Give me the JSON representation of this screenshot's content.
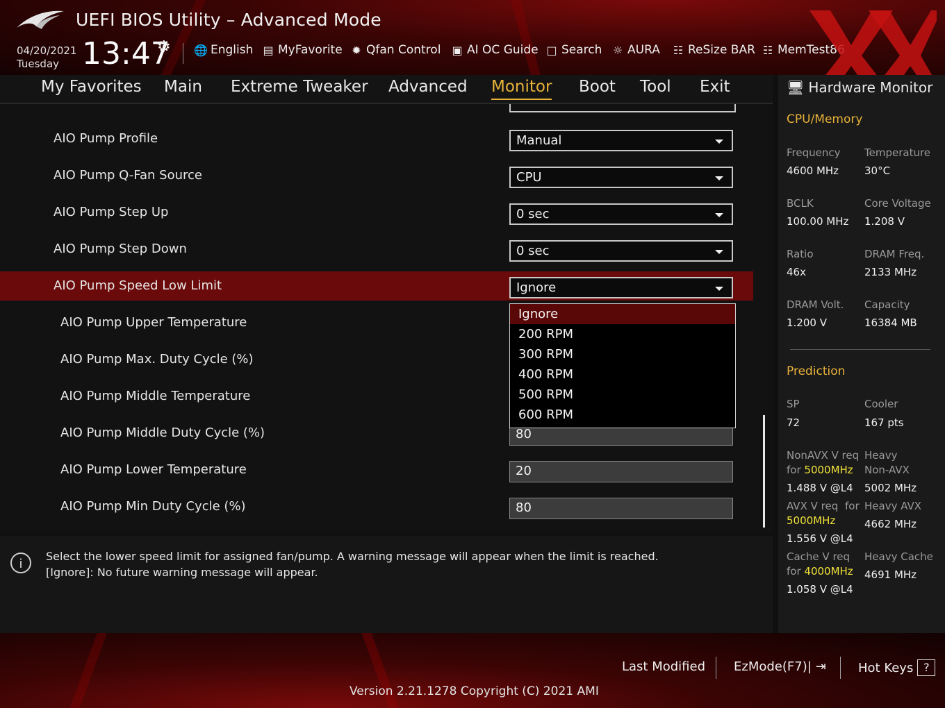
{
  "header": {
    "title": "UEFI BIOS Utility – Advanced Mode",
    "date": "04/20/2021",
    "day": "Tuesday",
    "time": "13:47",
    "tools": [
      {
        "label": "English",
        "icon": "globe-icon"
      },
      {
        "label": "MyFavorite",
        "icon": "favorite-icon"
      },
      {
        "label": "Qfan Control",
        "icon": "fan-icon"
      },
      {
        "label": "AI OC Guide",
        "icon": "chip-icon"
      },
      {
        "label": "Search",
        "icon": "help-box-icon"
      },
      {
        "label": "AURA",
        "icon": "light-icon"
      },
      {
        "label": "ReSize BAR",
        "icon": "resize-bar-icon"
      },
      {
        "label": "MemTest86",
        "icon": "memory-icon"
      }
    ]
  },
  "nav": {
    "tabs": [
      "My Favorites",
      "Main",
      "Extreme Tweaker",
      "Advanced",
      "Monitor",
      "Boot",
      "Tool",
      "Exit"
    ],
    "active": "Monitor"
  },
  "settings": [
    {
      "label": "AIO Pump Profile",
      "value": "Manual"
    },
    {
      "label": "AIO Pump Q-Fan Source",
      "value": "CPU"
    },
    {
      "label": "AIO Pump Step Up",
      "value": "0 sec"
    },
    {
      "label": "AIO Pump Step Down",
      "value": "0 sec"
    },
    {
      "label": "AIO Pump Speed Low Limit",
      "value": "Ignore"
    },
    {
      "label": "AIO Pump Upper Temperature",
      "value": ""
    },
    {
      "label": "AIO Pump Max. Duty Cycle (%)",
      "value": ""
    },
    {
      "label": "AIO Pump Middle Temperature",
      "value": ""
    },
    {
      "label": "AIO Pump Middle Duty Cycle (%)",
      "value": "80"
    },
    {
      "label": "AIO Pump Lower Temperature",
      "value": "20"
    },
    {
      "label": "AIO Pump Min Duty Cycle (%)",
      "value": "80"
    }
  ],
  "dropdown": {
    "options": [
      "Ignore",
      "200 RPM",
      "300 RPM",
      "400 RPM",
      "500 RPM",
      "600 RPM"
    ],
    "highlighted": "Ignore"
  },
  "info": {
    "line1": "Select the lower speed limit for assigned fan/pump. A warning message will appear when the limit is reached.",
    "line2": "[Ignore]: No future warning message will appear."
  },
  "hw_monitor": {
    "title": "Hardware Monitor",
    "cpu_memory": {
      "section": "CPU/Memory",
      "frequency_label": "Frequency",
      "frequency": "4600 MHz",
      "temperature_label": "Temperature",
      "temperature": "30°C",
      "bclk_label": "BCLK",
      "bclk": "100.00 MHz",
      "core_voltage_label": "Core Voltage",
      "core_voltage": "1.208 V",
      "ratio_label": "Ratio",
      "ratio": "46x",
      "dram_freq_label": "DRAM Freq.",
      "dram_freq": "2133 MHz",
      "dram_volt_label": "DRAM Volt.",
      "dram_volt": "1.200 V",
      "capacity_label": "Capacity",
      "capacity": "16384 MB"
    },
    "prediction": {
      "section": "Prediction",
      "sp_label": "SP",
      "sp": "72",
      "cooler_label": "Cooler",
      "cooler": "167 pts",
      "nonavx_label1": "NonAVX V req",
      "nonavx_for": "for",
      "nonavx_freq": "5000MHz",
      "nonavx_value": "1.488 V @L4",
      "heavy_nonavx_label1": "Heavy",
      "heavy_nonavx_label2": "Non-AVX",
      "heavy_nonavx": "5002 MHz",
      "avx_label1": "AVX V req",
      "avx_for": "for",
      "avx_freq": "5000MHz",
      "avx_value": "1.556 V @L4",
      "heavy_avx_label": "Heavy AVX",
      "heavy_avx": "4662 MHz",
      "cache_label1": "Cache V req",
      "cache_for": "for",
      "cache_freq": "4000MHz",
      "cache_value": "1.058 V @L4",
      "heavy_cache_label": "Heavy Cache",
      "heavy_cache": "4691 MHz"
    }
  },
  "footer": {
    "last_modified": "Last Modified",
    "ezmode": "EzMode(F7)|",
    "hotkeys": "Hot Keys",
    "hotkeys_key": "?",
    "version": "Version 2.21.1278 Copyright (C) 2021 AMI"
  },
  "colors": {
    "accent": "#e8b23a",
    "selection": "#6b0a0a",
    "highlight_freq": "#f1e23a"
  }
}
